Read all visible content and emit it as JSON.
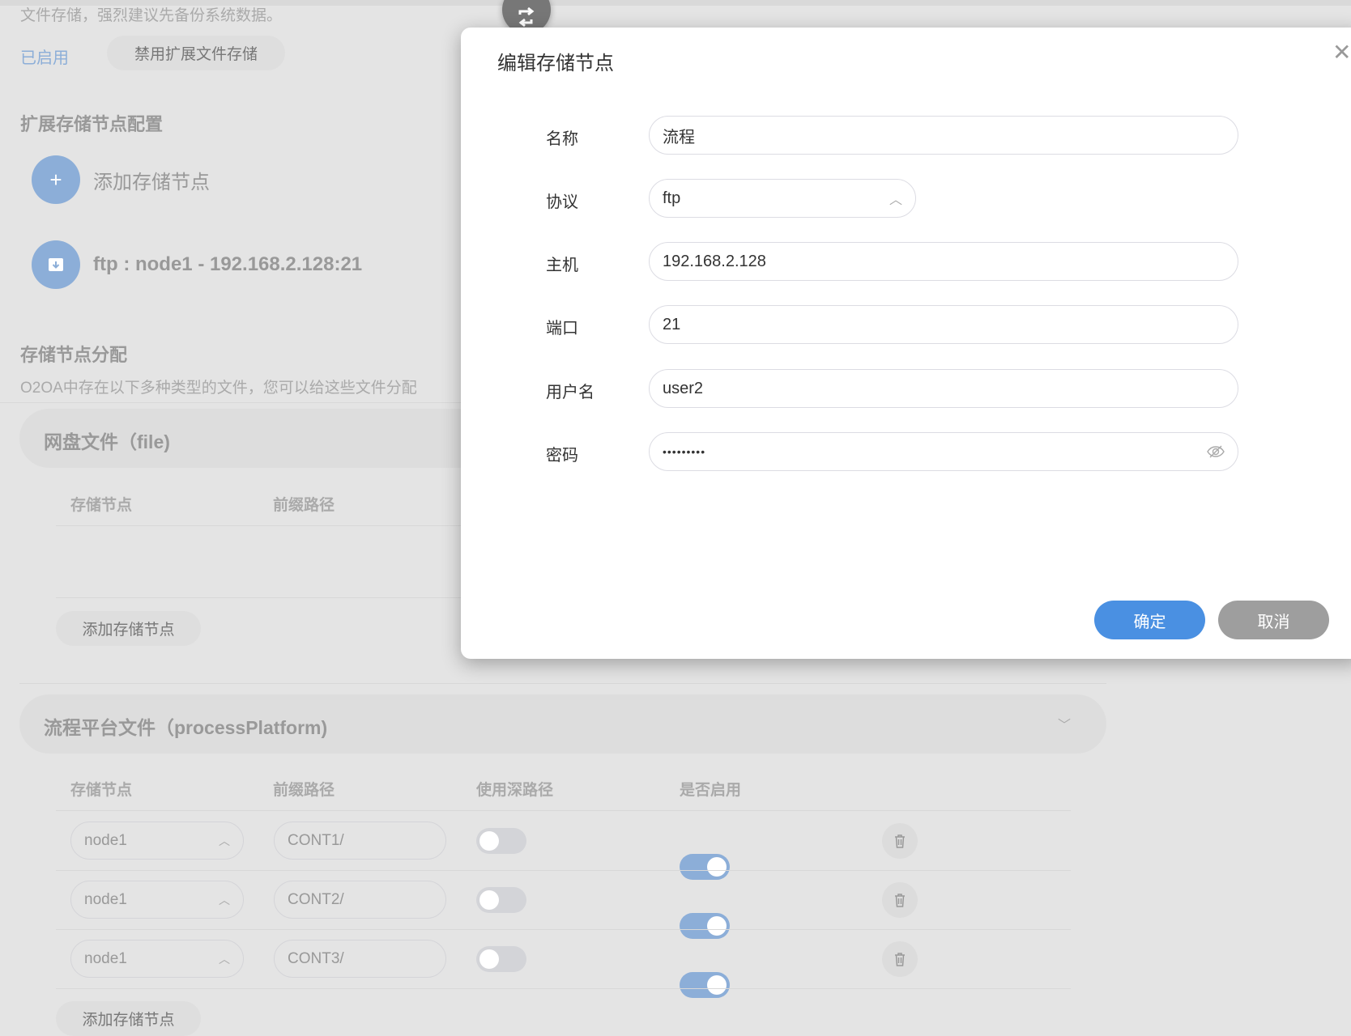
{
  "background": {
    "intro_text": "文件存储，强烈建议先备份系统数据。",
    "status_label": "已启用",
    "disable_button": "禁用扩展文件存储",
    "node_config_heading": "扩展存储节点配置",
    "add_node_label": "添加存储节点",
    "nodes": [
      {
        "label": "ftp : node1 - 192.168.2.128:21"
      }
    ],
    "allocation_heading": "存储节点分配",
    "allocation_desc": "O2OA中存在以下多种类型的文件，您可以给这些文件分配",
    "sections": [
      {
        "title": "网盘文件（file)",
        "columns": [
          "存储节点",
          "前缀路径"
        ],
        "rows": [],
        "add_button": "添加存储节点"
      },
      {
        "title": "流程平台文件（processPlatform)",
        "columns": [
          "存储节点",
          "前缀路径",
          "使用深路径",
          "是否启用"
        ],
        "rows": [
          {
            "node": "node1",
            "prefix": "CONT1/",
            "deep_path": false,
            "enabled": true
          },
          {
            "node": "node1",
            "prefix": "CONT2/",
            "deep_path": false,
            "enabled": true
          },
          {
            "node": "node1",
            "prefix": "CONT3/",
            "deep_path": false,
            "enabled": true
          }
        ],
        "add_button": "添加存储节点"
      }
    ]
  },
  "dialog": {
    "title": "编辑存储节点",
    "fields": {
      "name": {
        "label": "名称",
        "value": "流程"
      },
      "protocol": {
        "label": "协议",
        "value": "ftp"
      },
      "host": {
        "label": "主机",
        "value": "192.168.2.128"
      },
      "port": {
        "label": "端口",
        "value": "21"
      },
      "username": {
        "label": "用户名",
        "value": "user2"
      },
      "password": {
        "label": "密码",
        "value": "•••••••••"
      }
    },
    "confirm_button": "确定",
    "cancel_button": "取消"
  },
  "colors": {
    "accent": "#4a90e2",
    "cancel": "#9e9e9e",
    "toggle_on": "#8caed8",
    "toggle_off": "#d3d4d8"
  }
}
